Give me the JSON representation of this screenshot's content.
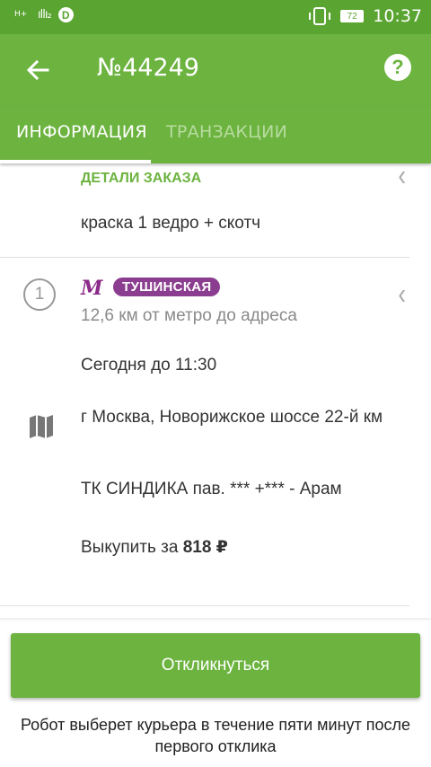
{
  "status_bar": {
    "network": "H+",
    "signal": "ıllı₂",
    "app_badge": "D",
    "battery": "72",
    "time": "10:37"
  },
  "toolbar": {
    "title": "№44249",
    "back_icon": "arrow-left-icon",
    "help_label": "?"
  },
  "tabs": [
    {
      "label": "ИНФОРМАЦИЯ",
      "active": true
    },
    {
      "label": "ТРАНЗАКЦИИ",
      "active": false
    }
  ],
  "order_details": {
    "header": "ДЕТАЛИ ЗАКАЗА",
    "description": "краска 1 ведро + скотч"
  },
  "stop": {
    "number": "1",
    "metro_symbol": "М",
    "metro_station": "ТУШИНСКАЯ",
    "metro_distance": "12,6 км от метро до адреса",
    "deadline": "Сегодня до 11:30",
    "address": "г Москва, Новорижское шоссе 22-й км",
    "contact": "ТК СИНДИКА пав. *** +*** - Арам",
    "buyout_label": "Выкупить за",
    "buyout_amount": "818 ₽"
  },
  "action": {
    "button_label": "Откликнуться",
    "note": "Робот выберет курьера в течение пяти минут после первого отклика"
  },
  "colors": {
    "primary": "#6cb33f",
    "status_bar": "#5aa431",
    "metro": "#8b3d8f"
  }
}
